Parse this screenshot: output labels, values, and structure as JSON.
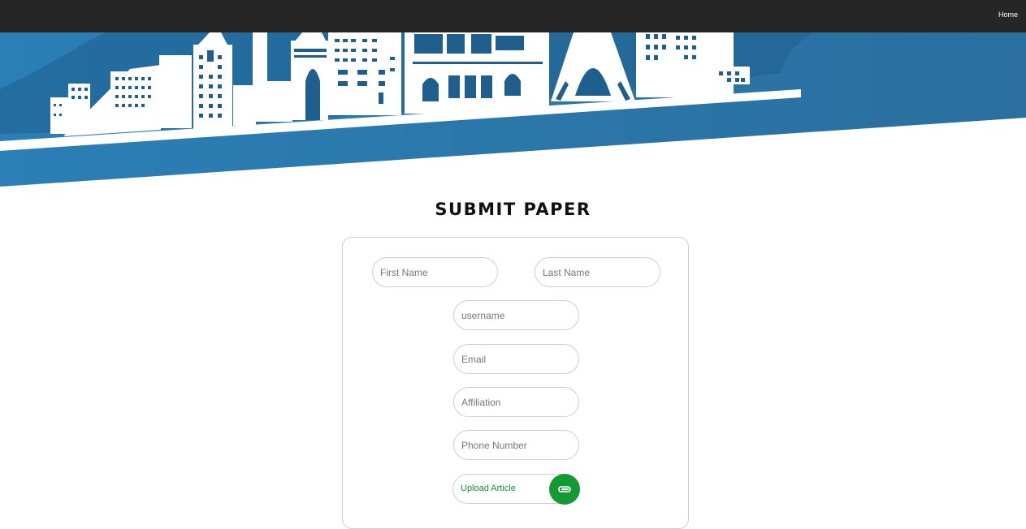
{
  "nav": {
    "home_label": "Home"
  },
  "page": {
    "title": "SUBMIT PAPER"
  },
  "form": {
    "first_name": {
      "placeholder": "First Name",
      "value": ""
    },
    "last_name": {
      "placeholder": "Last Name",
      "value": ""
    },
    "username": {
      "placeholder": "username",
      "value": ""
    },
    "email": {
      "placeholder": "Email",
      "value": ""
    },
    "affiliation": {
      "placeholder": "Affiliation",
      "value": ""
    },
    "phone": {
      "placeholder": "Phone Number",
      "value": ""
    },
    "upload": {
      "label": "Upload Article",
      "icon": "paperclip-icon"
    }
  },
  "colors": {
    "nav_bg": "#262626",
    "hero_blue": "#2a78ad",
    "hero_dark_blue": "#1d5b86",
    "upload_green": "#149a35",
    "upload_text": "#1e8c2d"
  }
}
